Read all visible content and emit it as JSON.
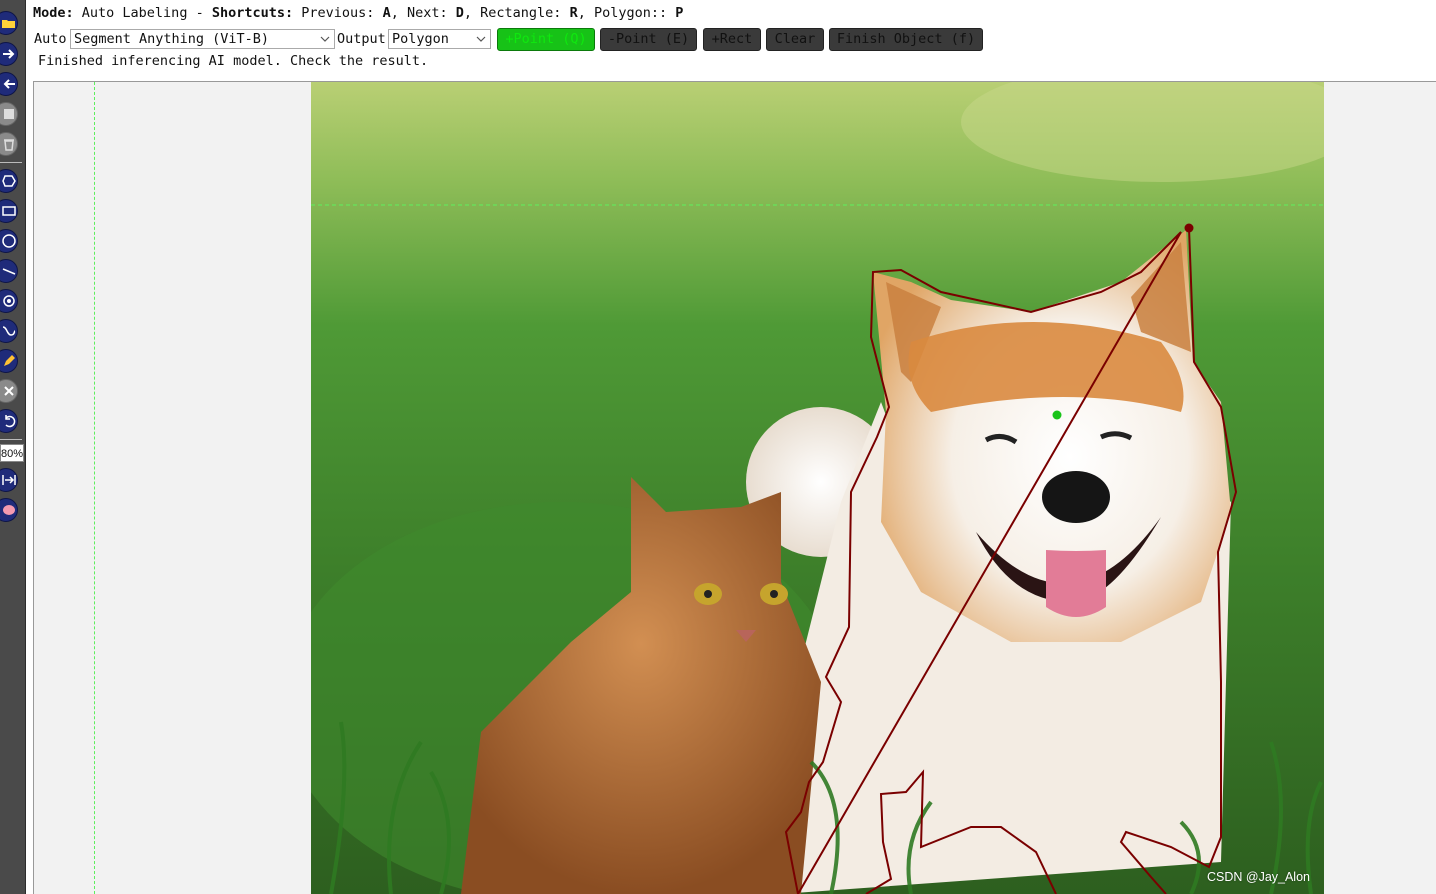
{
  "header": {
    "mode_label": "Mode:",
    "mode_value": "Auto Labeling",
    "shortcuts_label": "Shortcuts:",
    "prev_label": "Previous:",
    "prev_key": "A",
    "next_label": "Next:",
    "next_key": "D",
    "rect_label": "Rectangle:",
    "rect_key": "R",
    "poly_label": "Polygon::",
    "poly_key": "P"
  },
  "controls": {
    "auto_label": "Auto",
    "model_selected": "Segment Anything (ViT-B)",
    "output_label": "Output",
    "output_selected": "Polygon",
    "buttons": {
      "add_point": "+Point (Q)",
      "remove_point": "-Point (E)",
      "add_rect": "+Rect",
      "clear": "Clear",
      "finish": "Finish Object (f)"
    }
  },
  "status": "Finished inferencing AI model. Check the result.",
  "toolbar": {
    "zoom": "80%",
    "icons": [
      "open-folder-icon",
      "next-arrow-icon",
      "prev-arrow-icon",
      "save-icon",
      "delete-icon",
      "polygon-icon",
      "rectangle-icon",
      "circle-icon",
      "line-icon",
      "point-icon",
      "linestrip-icon",
      "edit-icon",
      "close-icon",
      "undo-icon",
      "fit-width-icon",
      "brain-icon"
    ]
  },
  "colors": {
    "active_button": "#17c217",
    "polygon_stroke": "#7a0000",
    "guide_line": "#5ef05e",
    "toolbar_bg": "#4a4a4a"
  },
  "canvas": {
    "subjects": [
      "cat",
      "dog"
    ],
    "watermark": "CSDN @Jay_Alon"
  }
}
